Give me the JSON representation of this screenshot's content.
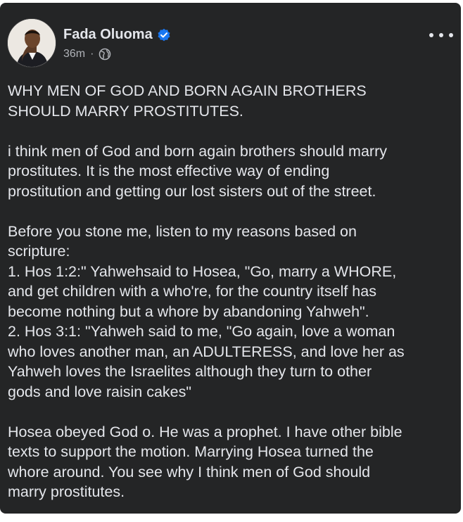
{
  "post": {
    "author": "Fada Oluoma",
    "time": "36m",
    "separator": "·",
    "audience_icon": "globe-icon",
    "verified_icon": "verified-badge-icon",
    "more_icon": "more-options-icon",
    "colors": {
      "card": "#242526",
      "text": "#e4e6eb",
      "meta": "#b0b3b8",
      "verified": "#1877f2"
    },
    "title_lines": [
      "WHY MEN OF GOD AND BORN AGAIN BROTHERS",
      "SHOULD MARRY PROSTITUTES."
    ],
    "para1_lines": [
      "i think men of God and born again brothers should marry",
      "prostitutes. It is the most effective way of ending",
      "prostitution and getting our lost sisters out of the street."
    ],
    "para2_lines": [
      "Before you stone me, listen to my reasons based on",
      "scripture:",
      "1. Hos 1:2:\" Yahwehsaid to Hosea,  \"Go, marry a WHORE,",
      "and get children with a who're,  for the country itself has",
      "become nothing but a whore by abandoning Yahweh\".",
      "2. Hos 3:1: \"Yahweh said to me, \"Go again, love a woman",
      "who loves another man, an ADULTERESS,  and love her as",
      "Yahweh loves the Israelites although they turn to other",
      "gods and love raisin cakes\""
    ],
    "para3_lines": [
      "Hosea obeyed God o. He was a prophet. I have other bible",
      "texts to support the motion. Marrying Hosea turned the",
      "whore around. You see why I think men of God should",
      "marry prostitutes."
    ]
  }
}
